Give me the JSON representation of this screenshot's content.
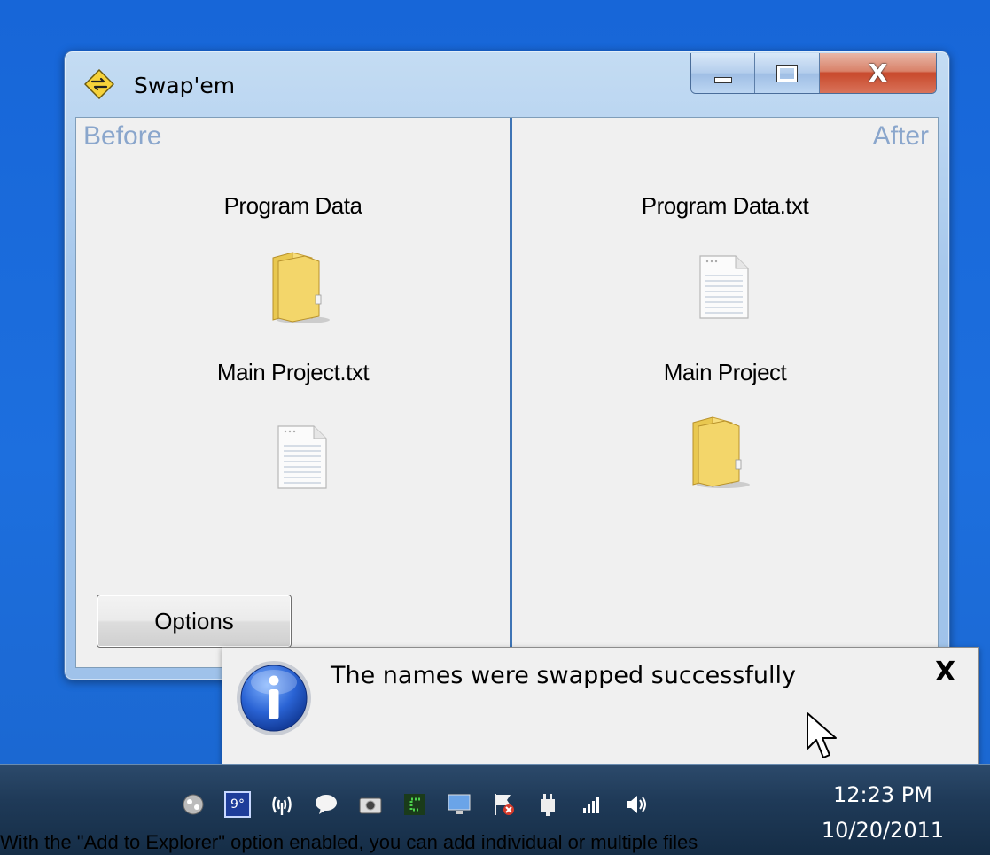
{
  "window": {
    "title": "Swap'em",
    "controls": {
      "minimize": "minimize-icon",
      "maximize": "maximize-icon",
      "close": "X"
    }
  },
  "before": {
    "label": "Before",
    "items": [
      {
        "name": "Program Data",
        "icon": "folder-icon"
      },
      {
        "name": "Main Project.txt",
        "icon": "text-file-icon"
      }
    ]
  },
  "after": {
    "label": "After",
    "items": [
      {
        "name": "Program Data.txt",
        "icon": "text-file-icon"
      },
      {
        "name": "Main Project",
        "icon": "folder-icon"
      }
    ]
  },
  "options_button": "Options",
  "notification": {
    "message": "The names were swapped successfully",
    "close": "X",
    "icon": "info-icon"
  },
  "taskbar": {
    "time": "12:23 PM",
    "date": "10/20/2011",
    "tray_badge": "9°"
  },
  "caption_text": "With the \"Add to Explorer\" option enabled, you can add individual or multiple files"
}
